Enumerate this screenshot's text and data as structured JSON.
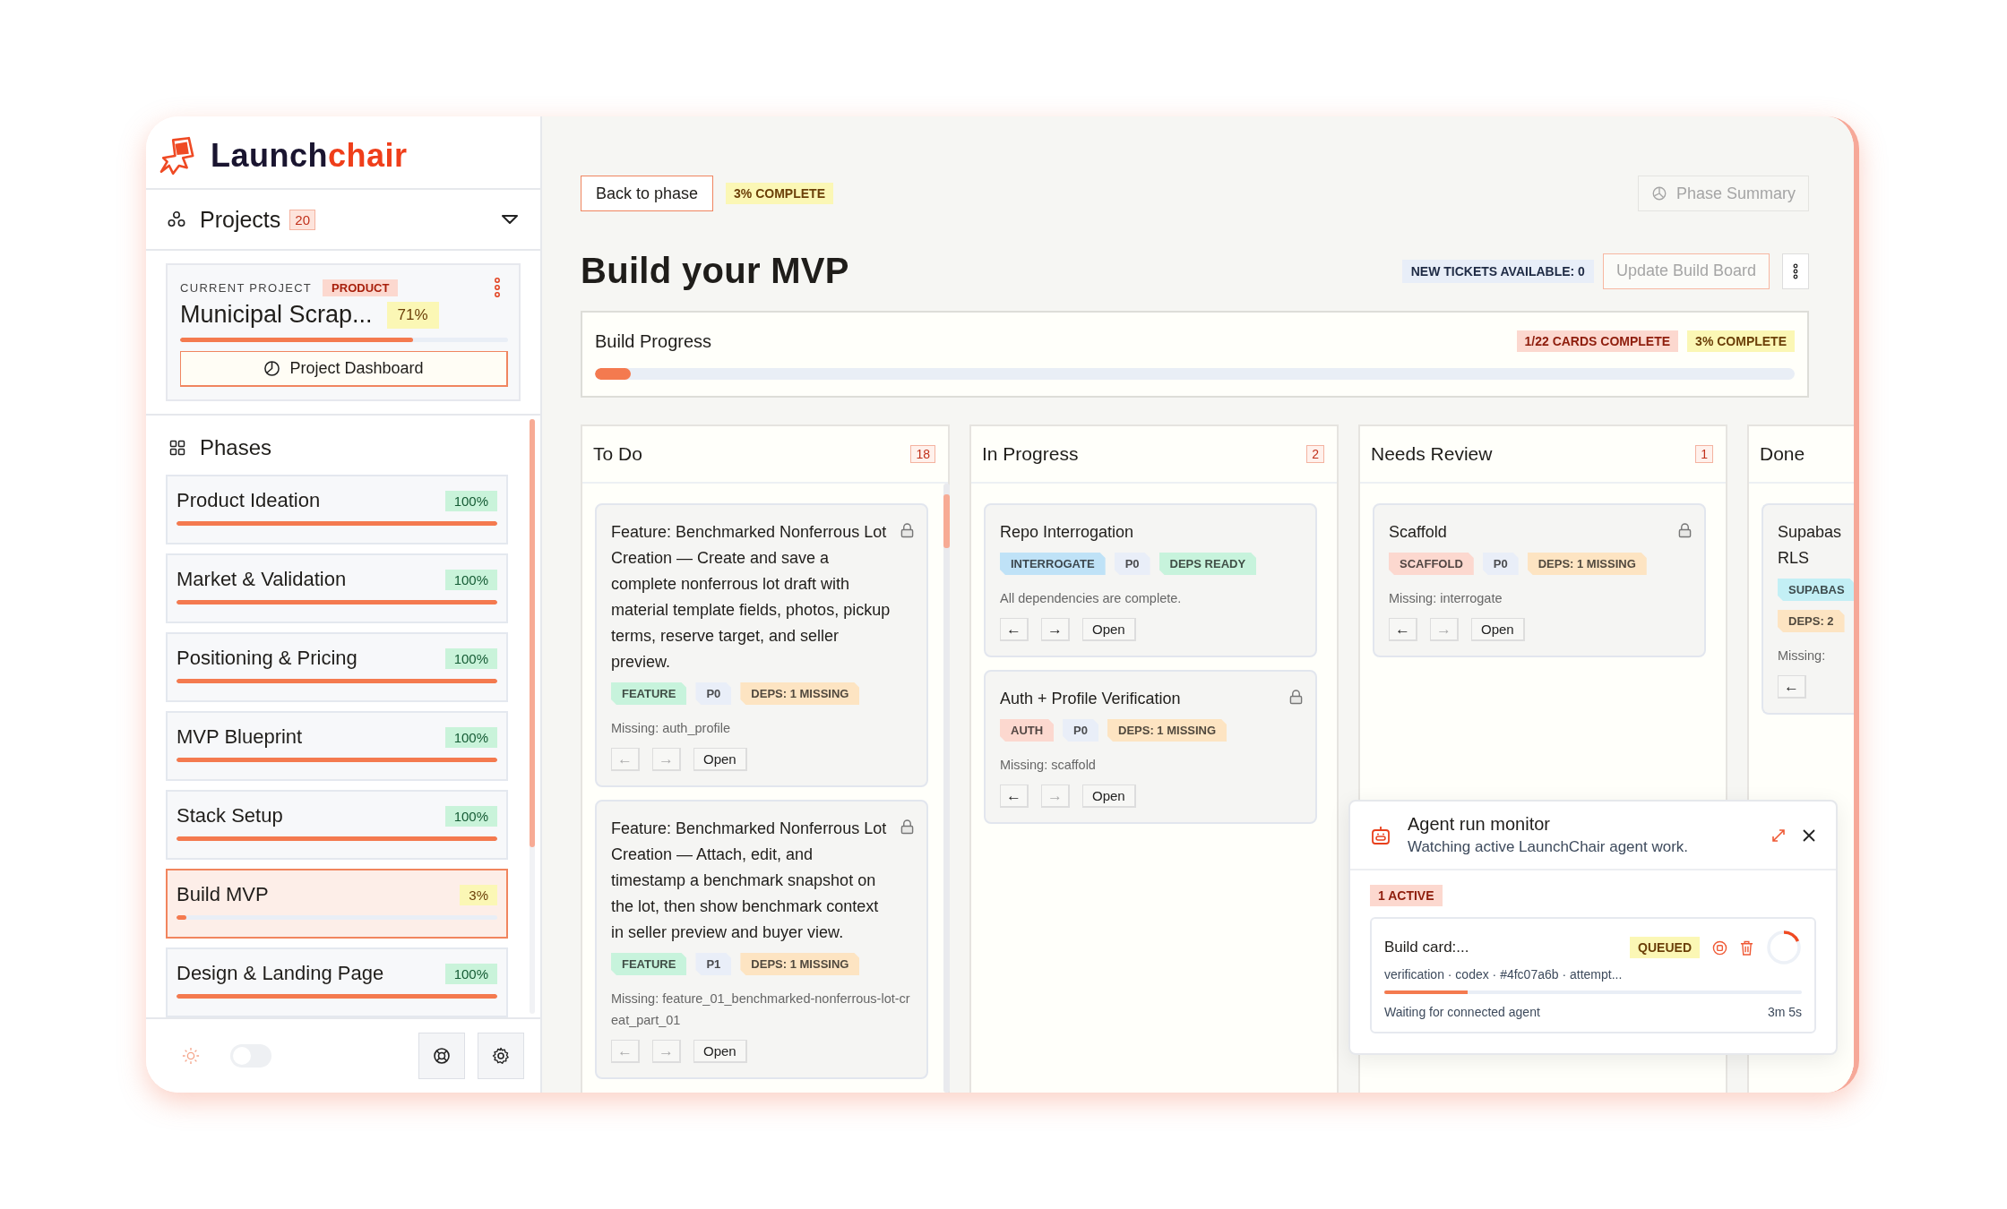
{
  "logo": {
    "text": "Launch",
    "accent": "chair"
  },
  "projects": {
    "label": "Projects",
    "count": "20"
  },
  "current_project": {
    "caption": "CURRENT PROJECT",
    "tag": "PRODUCT",
    "name": "Municipal Scrap...",
    "percent": "71%",
    "level": 0.71,
    "dashboard_button": "Project Dashboard"
  },
  "phases": {
    "title": "Phases",
    "items": [
      {
        "name": "Product Ideation",
        "percent": "100%",
        "level": 1,
        "selected": false
      },
      {
        "name": "Market & Validation",
        "percent": "100%",
        "level": 1,
        "selected": false
      },
      {
        "name": "Positioning & Pricing",
        "percent": "100%",
        "level": 1,
        "selected": false
      },
      {
        "name": "MVP Blueprint",
        "percent": "100%",
        "level": 1,
        "selected": false
      },
      {
        "name": "Stack Setup",
        "percent": "100%",
        "level": 1,
        "selected": false
      },
      {
        "name": "Build MVP",
        "percent": "3%",
        "level": 0.03,
        "selected": true
      },
      {
        "name": "Design & Landing Page",
        "percent": "100%",
        "level": 1,
        "selected": false
      }
    ]
  },
  "theme_toggle": {
    "on": false
  },
  "header": {
    "back_button": "Back to phase",
    "complete_badge": "3% COMPLETE",
    "summary_button": {
      "label": "Phase Summary",
      "disabled": true
    },
    "title": "Build your MVP",
    "tickets_badge": "NEW TICKETS AVAILABLE: 0",
    "update_button": {
      "label": "Update Build Board",
      "disabled": true
    }
  },
  "progress": {
    "title": "Build Progress",
    "cards_badge": "1/22 CARDS COMPLETE",
    "complete_badge": "3% COMPLETE",
    "level": 0.03
  },
  "columns": [
    {
      "title": "To Do",
      "count": "18",
      "cards": [
        {
          "title": "Feature: Benchmarked Nonferrous Lot Creation — Create and save a complete nonferrous lot draft with material template fields, photos, pickup terms, reserve target, and seller preview.",
          "locked": true,
          "tags": [
            {
              "label": "FEATURE",
              "color": "#c7f3dc"
            },
            {
              "label": "P0",
              "color": "#e9eef8"
            },
            {
              "label": "DEPS: 1 MISSING",
              "color": "#fde4c2"
            }
          ],
          "note": "Missing: auth_profile",
          "back": {
            "label": "←",
            "disabled": true
          },
          "forward": {
            "label": "→",
            "disabled": true
          },
          "open": "Open"
        },
        {
          "title": "Feature: Benchmarked Nonferrous Lot Creation — Attach, edit, and timestamp a benchmark snapshot on the lot, then show benchmark context in seller preview and buyer view.",
          "locked": true,
          "tags": [
            {
              "label": "FEATURE",
              "color": "#c7f3dc"
            },
            {
              "label": "P1",
              "color": "#e9eef8"
            },
            {
              "label": "DEPS: 1 MISSING",
              "color": "#fde4c2"
            }
          ],
          "note": "Missing: feature_01_benchmarked-nonferrous-lot-creat_part_01",
          "back": {
            "label": "←",
            "disabled": true
          },
          "forward": {
            "label": "→",
            "disabled": true
          },
          "open": "Open"
        }
      ]
    },
    {
      "title": "In Progress",
      "count": "2",
      "cards": [
        {
          "title": "Repo Interrogation",
          "locked": false,
          "tags": [
            {
              "label": "INTERROGATE",
              "color": "#bfe2f7"
            },
            {
              "label": "P0",
              "color": "#e9eef8"
            },
            {
              "label": "DEPS READY",
              "color": "#c7f3dc"
            }
          ],
          "note": "All dependencies are complete.",
          "back": {
            "label": "←",
            "disabled": false
          },
          "forward": {
            "label": "→",
            "disabled": false
          },
          "open": "Open"
        },
        {
          "title": "Auth + Profile Verification",
          "locked": true,
          "tags": [
            {
              "label": "AUTH",
              "color": "#fcd8cf"
            },
            {
              "label": "P0",
              "color": "#e9eef8"
            },
            {
              "label": "DEPS: 1 MISSING",
              "color": "#fde4c2"
            }
          ],
          "note": "Missing: scaffold",
          "back": {
            "label": "←",
            "disabled": false
          },
          "forward": {
            "label": "→",
            "disabled": true
          },
          "open": "Open"
        }
      ]
    },
    {
      "title": "Needs Review",
      "count": "1",
      "cards": [
        {
          "title": "Scaffold",
          "locked": true,
          "tags": [
            {
              "label": "SCAFFOLD",
              "color": "#fcd8cf"
            },
            {
              "label": "P0",
              "color": "#e9eef8"
            },
            {
              "label": "DEPS: 1 MISSING",
              "color": "#fde4c2"
            }
          ],
          "note": "Missing: interrogate",
          "back": {
            "label": "←",
            "disabled": false
          },
          "forward": {
            "label": "→",
            "disabled": true
          },
          "open": "Open"
        }
      ]
    },
    {
      "title": "Done",
      "cards": [
        {
          "title": "Supabas RLS",
          "locked": false,
          "tags": [
            {
              "label": "SUPABAS",
              "color": "#c3eff5"
            },
            {
              "label": "DEPS: 2",
              "color": "#fde4c2"
            }
          ],
          "note": "Missing:",
          "back": {
            "label": "←",
            "disabled": false
          }
        }
      ]
    }
  ],
  "monitor": {
    "title": "Agent run monitor",
    "subtitle": "Watching active LaunchChair agent work.",
    "active_badge": "1 ACTIVE",
    "run": {
      "title": "Build card:...",
      "status": "QUEUED",
      "meta": "verification · codex · #4fc07a6b · attempt...",
      "level": 0.2,
      "message": "Waiting for connected agent",
      "elapsed": "3m 5s"
    }
  }
}
